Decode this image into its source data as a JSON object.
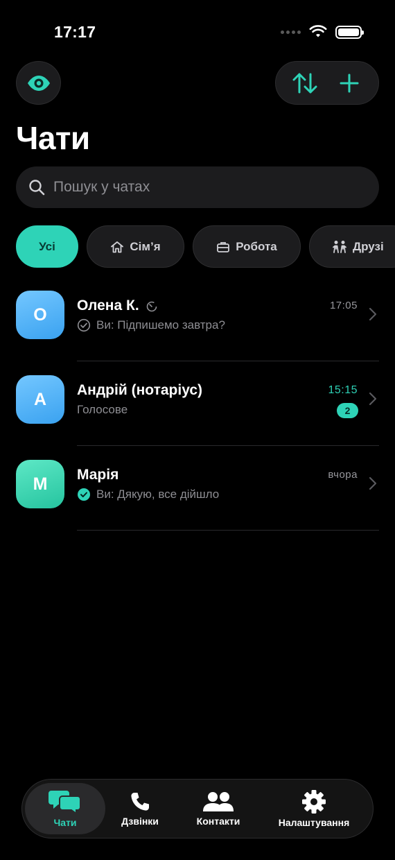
{
  "status_bar": {
    "time": "17:17"
  },
  "header": {
    "title": "Чати"
  },
  "search": {
    "placeholder": "Пошук у чатах"
  },
  "filters": [
    {
      "label": "Усі",
      "icon": "none",
      "active": true
    },
    {
      "label": "Сім’я",
      "icon": "home-icon",
      "active": false
    },
    {
      "label": "Робота",
      "icon": "briefcase-icon",
      "active": false
    },
    {
      "label": "Друзі",
      "icon": "people-icon",
      "active": false
    }
  ],
  "chats": [
    {
      "initial": "О",
      "name": "Олена К.",
      "name_icon": "timer-icon",
      "preview": "Ви: Підпишемо завтра?",
      "status_icon": "check-outline-icon",
      "time": "17:05",
      "unread": null
    },
    {
      "initial": "А",
      "name": "Андрій (нотаріус)",
      "preview": "Голосове",
      "time": "15:15",
      "unread": "2"
    },
    {
      "initial": "М",
      "name": "Марія",
      "preview": "Ви: Дякую, все дійшло",
      "status_icon": "check-filled-icon",
      "time": "вчора",
      "unread": null
    }
  ],
  "tabs": [
    {
      "label": "Чати",
      "icon": "chat-bubbles-icon",
      "active": true
    },
    {
      "label": "Дзвінки",
      "icon": "phone-icon",
      "active": false
    },
    {
      "label": "Контакти",
      "icon": "contacts-icon",
      "active": false
    },
    {
      "label": "Налаштування",
      "icon": "gear-icon",
      "active": false
    }
  ],
  "colors": {
    "accent": "#2ed3b7",
    "background": "#000000",
    "surface": "#1c1c1e"
  }
}
